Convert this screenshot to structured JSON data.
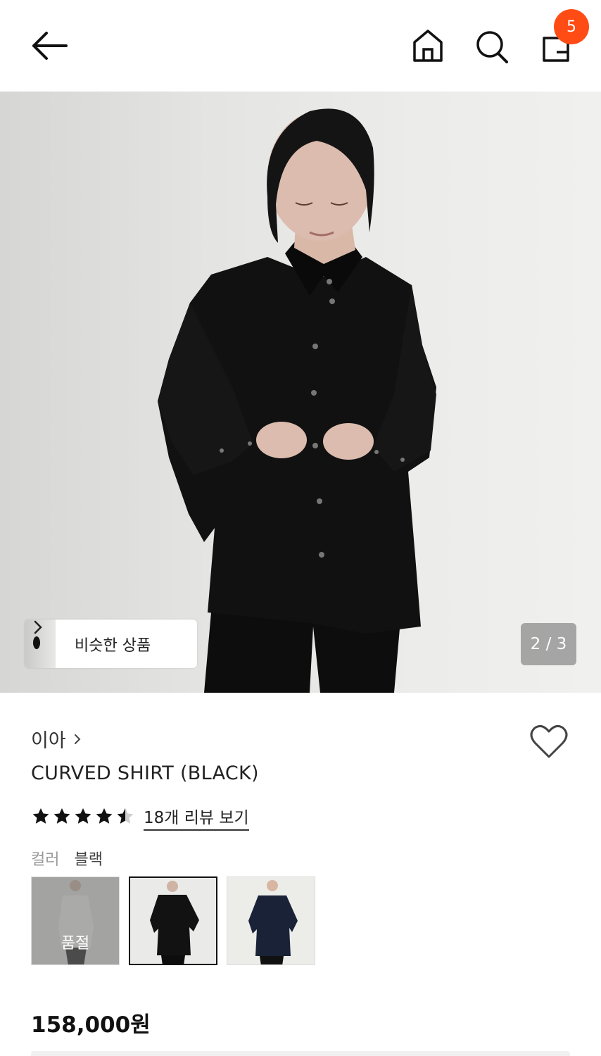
{
  "header": {
    "icons": [
      "back-arrow-icon",
      "home-icon",
      "search-icon",
      "shopping-bag-icon"
    ],
    "cart_count": "5",
    "accent_color": "#ff4b14"
  },
  "gallery": {
    "similar_label": "비슷한 상품",
    "counter": "2 / 3",
    "current_image": 2,
    "total_images": 3
  },
  "product": {
    "brand": "이아",
    "name": "CURVED SHIRT (BLACK)",
    "rating": 4.5,
    "review_link": "18개 리뷰 보기",
    "color_label": "컬러",
    "color_value": "블랙",
    "swatches": [
      {
        "color": "white",
        "badge": "품절",
        "sold_out": true
      },
      {
        "color": "black",
        "selected": true
      },
      {
        "color": "navy"
      }
    ],
    "price": "158,000원"
  }
}
